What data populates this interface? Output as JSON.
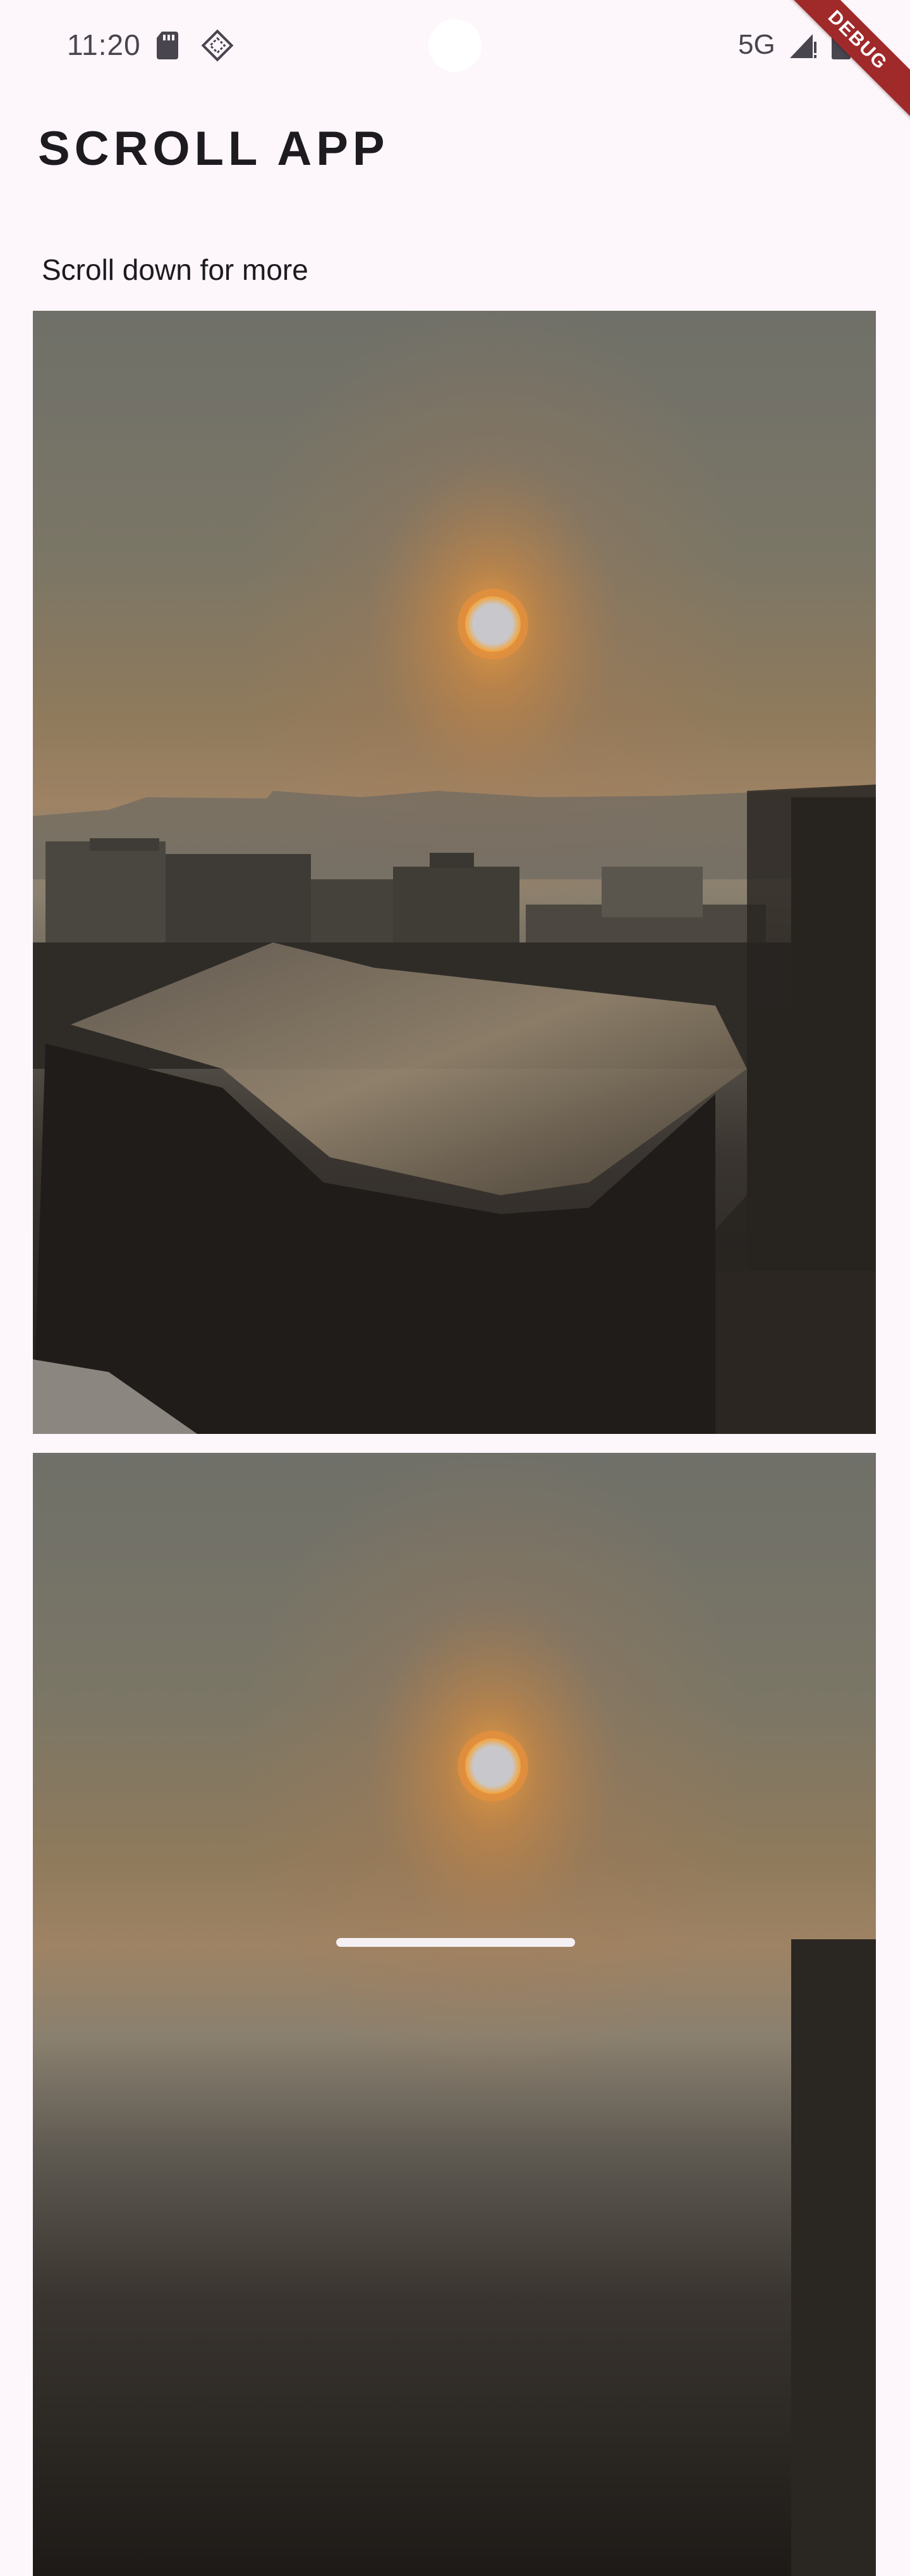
{
  "status_bar": {
    "time": "11:20",
    "network": "5G",
    "icons": [
      "sd-card-icon",
      "diamond-notification-icon",
      "signal-icon",
      "battery-icon"
    ]
  },
  "debug_banner": {
    "label": "DEBUG",
    "color": "#a0292a"
  },
  "app_bar": {
    "title": "SCROLL APP"
  },
  "content": {
    "subtitle": "Scroll down for more",
    "images": [
      {
        "description_icon": "city-sunrise-photo"
      },
      {
        "description_icon": "city-sunrise-photo"
      }
    ]
  },
  "colors": {
    "background": "#fdf6fb",
    "text": "#1d1b20",
    "status_text": "#49454f"
  }
}
